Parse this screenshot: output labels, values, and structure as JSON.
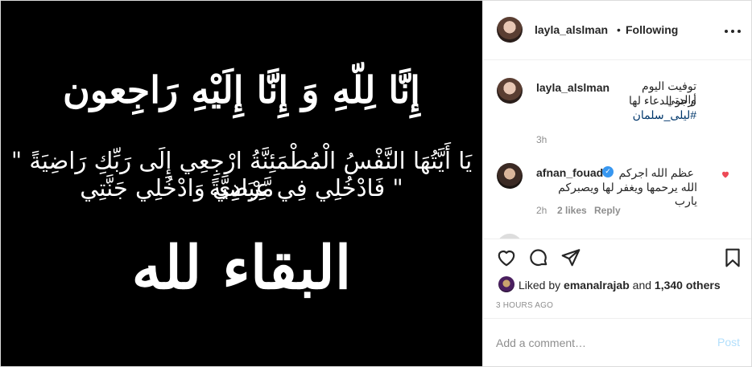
{
  "image": {
    "line1": "إِنَّا لِلّهِ وَ إِنَّا إِلَيْهِ رَاجِعون",
    "line2": "\" يَا أَيَّتُهَا النَّفْسُ الْمُطْمَئِنَّةُ ارْجِعِي إِلَى رَبِّكِ رَاضِيَةً مَّرْضِيَّةً",
    "line3": "فَادْخُلِي فِي عِبَادِي وَادْخُلِي جَنَّتِي \"",
    "line4": "البقاء لله"
  },
  "header": {
    "username": "layla_alslman",
    "separator": "•",
    "follow_status": "Following"
  },
  "caption": {
    "username": "layla_alslman",
    "line1": "توفيت اليوم والدتي",
    "line2": "أرجو الدعاء لها",
    "hashtag": "#ليلى_سلمان",
    "time": "3h"
  },
  "comment": {
    "username": "afnan_fouad",
    "line1": "عظم الله اجركم ،،",
    "line2": "الله يرحمها ويغفر لها ويصبركم يارب",
    "time": "2h",
    "likes": "2 likes",
    "reply": "Reply"
  },
  "likes": {
    "prefix": "Liked by",
    "user": "emanalrajab",
    "joiner": "and",
    "others": "1,340 others"
  },
  "timestamp": "3 HOURS AGO",
  "add_comment": {
    "placeholder": "Add a comment…",
    "post_label": "Post"
  },
  "colors": {
    "text": "#262626",
    "muted": "#8e8e8e",
    "link": "#00376b",
    "verified": "#3897f0",
    "like_red": "#ed4956",
    "post_disabled": "#b2dffc"
  }
}
